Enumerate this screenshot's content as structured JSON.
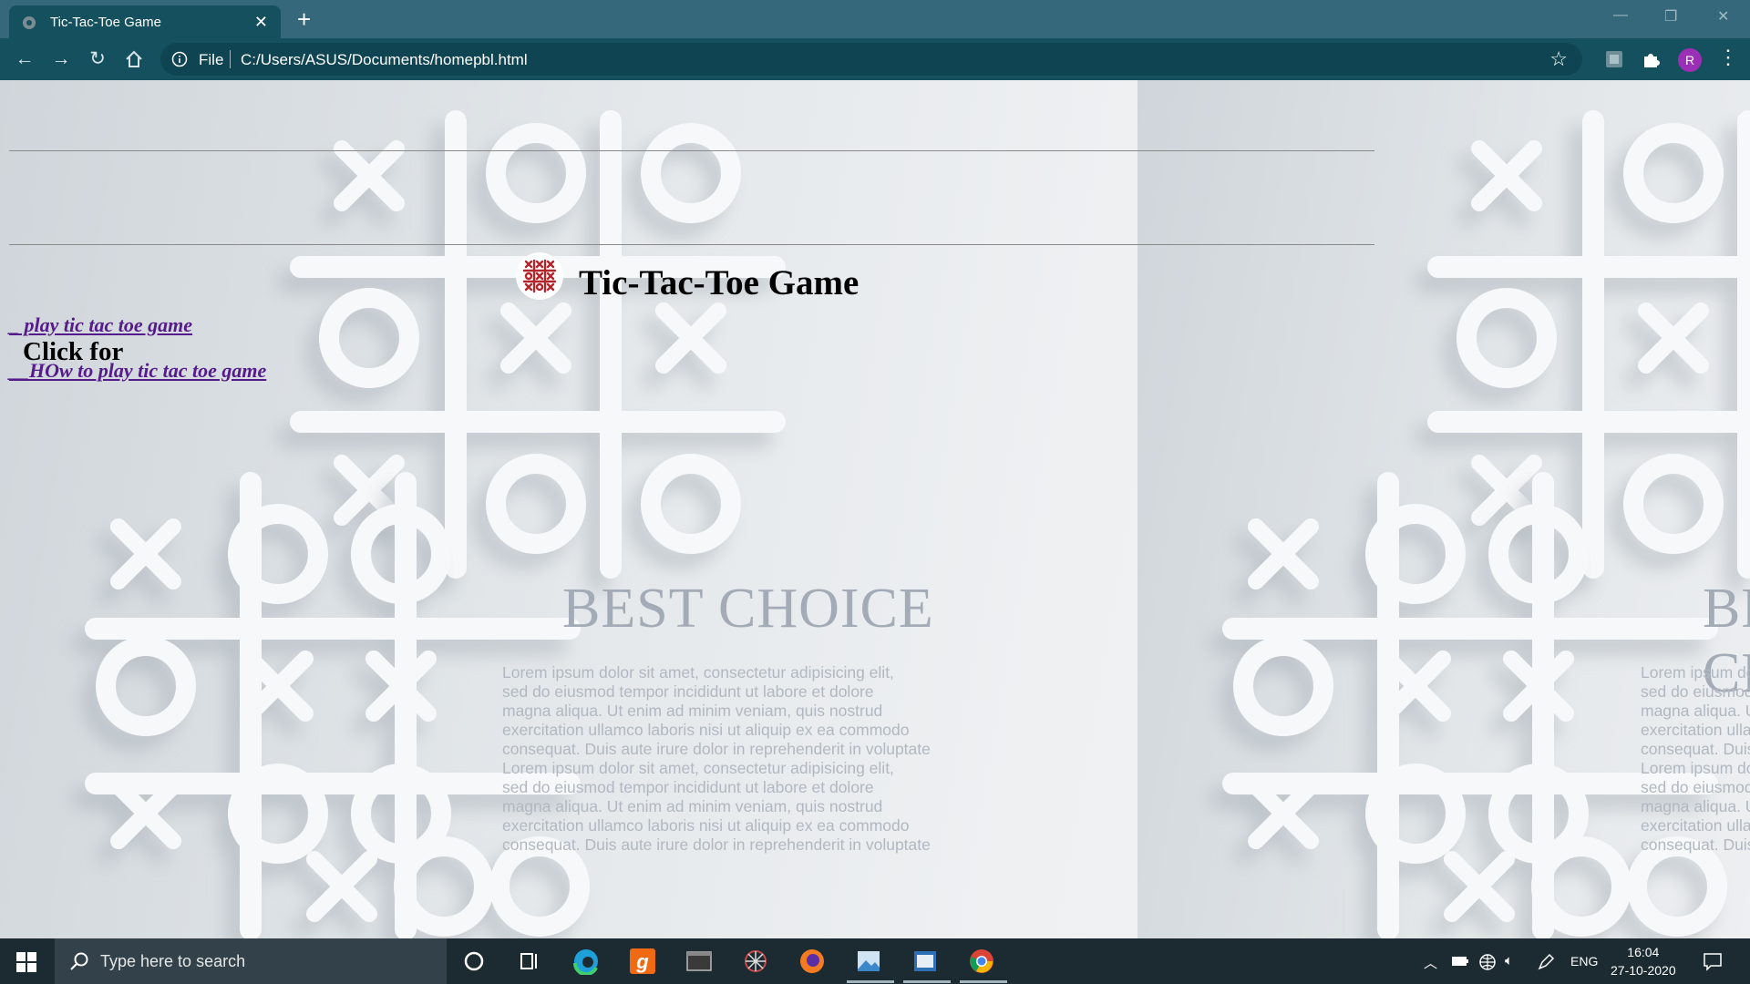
{
  "browser": {
    "tab_title": "Tic-Tac-Toe Game",
    "new_tab_label": "+",
    "address_scheme": "File",
    "address_url": "C:/Users/ASUS/Documents/homepbl.html",
    "profile_initial": "R"
  },
  "page": {
    "heading": "Tic-Tac-Toe Game",
    "subheading": "Click for",
    "links": [
      {
        "label": "_ play tic tac toe game"
      },
      {
        "label": "__HOw to play tic tac toe game"
      }
    ],
    "background": {
      "tagline": "BEST CHOICE",
      "lorem_lines": [
        "Lorem ipsum dolor sit amet, consectetur adipisicing elit,",
        "sed do eiusmod tempor incididunt ut labore et dolore",
        "magna aliqua. Ut enim ad minim veniam, quis nostrud",
        "exercitation ullamco laboris nisi ut aliquip ex ea commodo",
        "consequat. Duis aute irure dolor in reprehenderit in voluptate",
        "Lorem ipsum dolor sit amet, consectetur adipisicing elit,",
        "sed do eiusmod tempor incididunt ut labore et dolore",
        "magna aliqua. Ut enim ad minim veniam, quis nostrud",
        "exercitation ullamco laboris nisi ut aliquip ex ea commodo",
        "consequat. Duis aute irure dolor in reprehenderit in voluptate"
      ]
    }
  },
  "taskbar": {
    "search_placeholder": "Type here to search",
    "language": "ENG",
    "time": "16:04",
    "date": "27-10-2020"
  },
  "colors": {
    "tab_bar": "#35687a",
    "toolbar": "#15505f",
    "link_visited": "#551a8b",
    "taskbar": "#1c2a31"
  }
}
